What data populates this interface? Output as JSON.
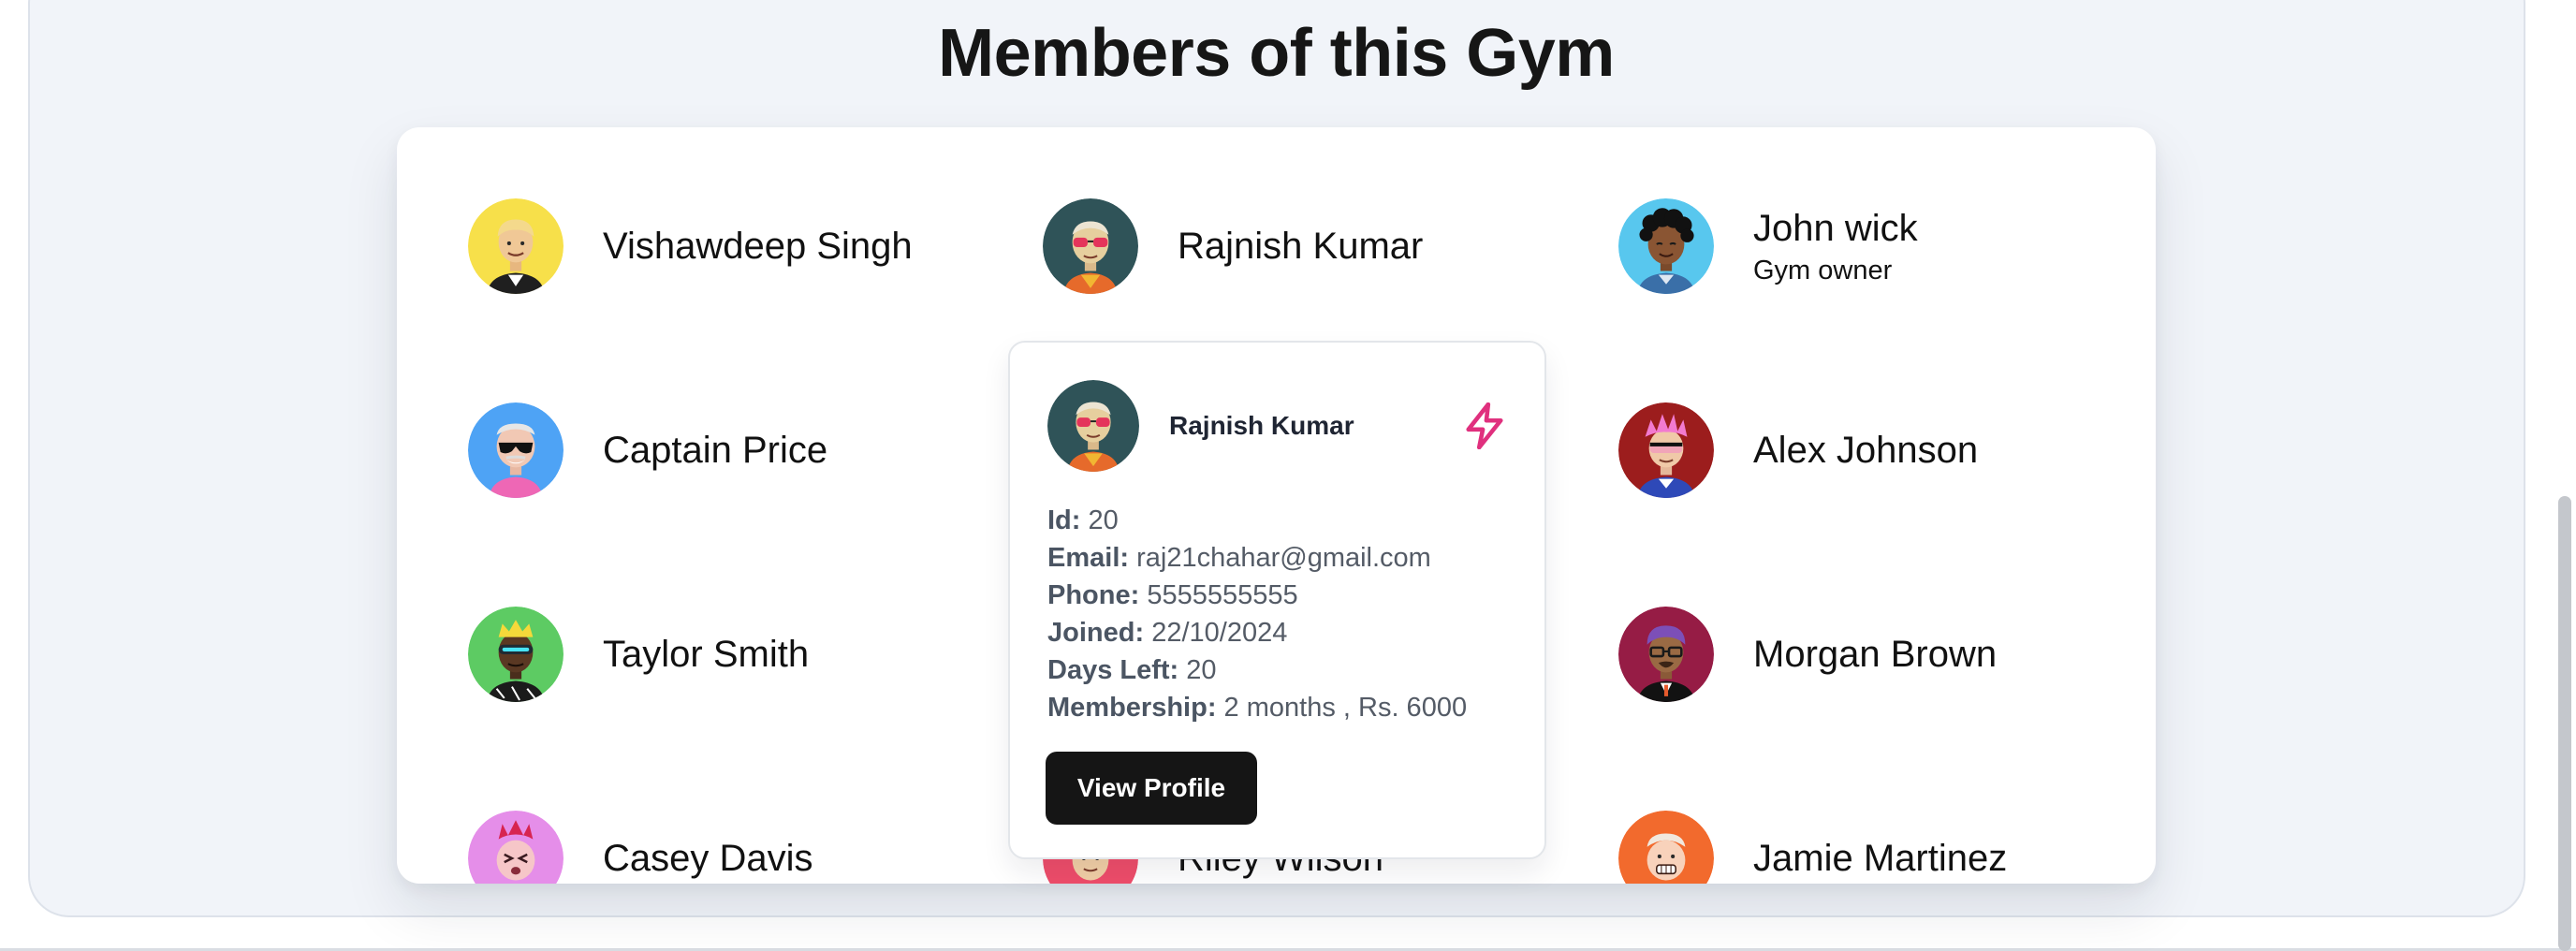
{
  "page": {
    "title": "Members of this Gym"
  },
  "members": [
    {
      "name": "Vishawdeep Singh",
      "role": "",
      "avatar": "avatar-blonde-man-icon",
      "bg": "#f7e04a"
    },
    {
      "name": "Rajnish Kumar",
      "role": "",
      "avatar": "avatar-sunglasses-man-icon",
      "bg": "#2f5358"
    },
    {
      "name": "John wick",
      "role": "Gym owner",
      "avatar": "avatar-curly-hair-man-icon",
      "bg": "#58c7ee"
    },
    {
      "name": "Captain Price",
      "role": "",
      "avatar": "avatar-bald-sunglasses-icon",
      "bg": "#4ea3f5"
    },
    {
      "name": "Alex Johnson",
      "role": "",
      "avatar": "avatar-pink-hair-icon",
      "bg": "#9c1d1d"
    },
    {
      "name": "Taylor Smith",
      "role": "",
      "avatar": "avatar-crown-visor-icon",
      "bg": "#5dcb63"
    },
    {
      "name": "Morgan Brown",
      "role": "",
      "avatar": "avatar-purple-hair-glasses-icon",
      "bg": "#961c45"
    },
    {
      "name": "Casey Davis",
      "role": "",
      "avatar": "avatar-winking-face-icon",
      "bg": "#e58ee9"
    },
    {
      "name": "Riley Wilson",
      "role": "",
      "avatar": "avatar-redhead-icon",
      "bg": "#ef4d6a"
    },
    {
      "name": "Jamie Martinez",
      "role": "",
      "avatar": "avatar-grinning-face-icon",
      "bg": "#f26a2d"
    }
  ],
  "popover": {
    "name": "Rajnish Kumar",
    "icon": "lightning-bolt-icon",
    "icon_color": "#e0307e",
    "fields": [
      {
        "label": "Id:",
        "value": "20"
      },
      {
        "label": "Email:",
        "value": "raj21chahar@gmail.com"
      },
      {
        "label": "Phone:",
        "value": "5555555555"
      },
      {
        "label": "Joined:",
        "value": "22/10/2024"
      },
      {
        "label": "Days Left:",
        "value": "20"
      },
      {
        "label": "Membership:",
        "value": "2 months , Rs. 6000"
      }
    ],
    "button_label": "View Profile"
  }
}
